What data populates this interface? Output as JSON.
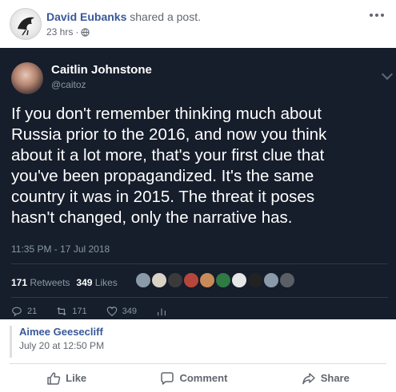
{
  "post": {
    "author": "David Eubanks",
    "action": "shared a post.",
    "time": "23 hrs",
    "separator": "·",
    "audience_icon": "globe-icon",
    "more_icon": "more-dots-icon"
  },
  "tweet": {
    "name": "Caitlin Johnstone",
    "handle": "@caitoz",
    "text": "If you don't remember thinking much about\nRussia prior to the 2016, and now you think\nabout it a lot more, that's your first clue that\nyou've been propagandized. It's the same\ncountry it was in 2015. The threat it poses\nhasn't changed, only the narrative has.",
    "timestamp": "11:35 PM - 17 Jul 2018",
    "retweets_count": "171",
    "retweets_label": "Retweets",
    "likes_count": "349",
    "likes_label": "Likes",
    "likers": [
      "#8a9aa8",
      "#d9d3c6",
      "#3a3a3a",
      "#b6463b",
      "#c98a5a",
      "#2f7a45",
      "#e6e6e6",
      "#222222",
      "#8a9aa8",
      "#5a5f66"
    ],
    "actions": {
      "replies": "21",
      "retweets": "171",
      "likes": "349"
    }
  },
  "source": {
    "name": "Aimee Geesecliff",
    "date": "July 20 at 12:50 PM"
  },
  "actions": {
    "like": "Like",
    "comment": "Comment",
    "share": "Share"
  },
  "colors": {
    "link_blue": "#385898",
    "tweet_bg": "#161d2b"
  }
}
